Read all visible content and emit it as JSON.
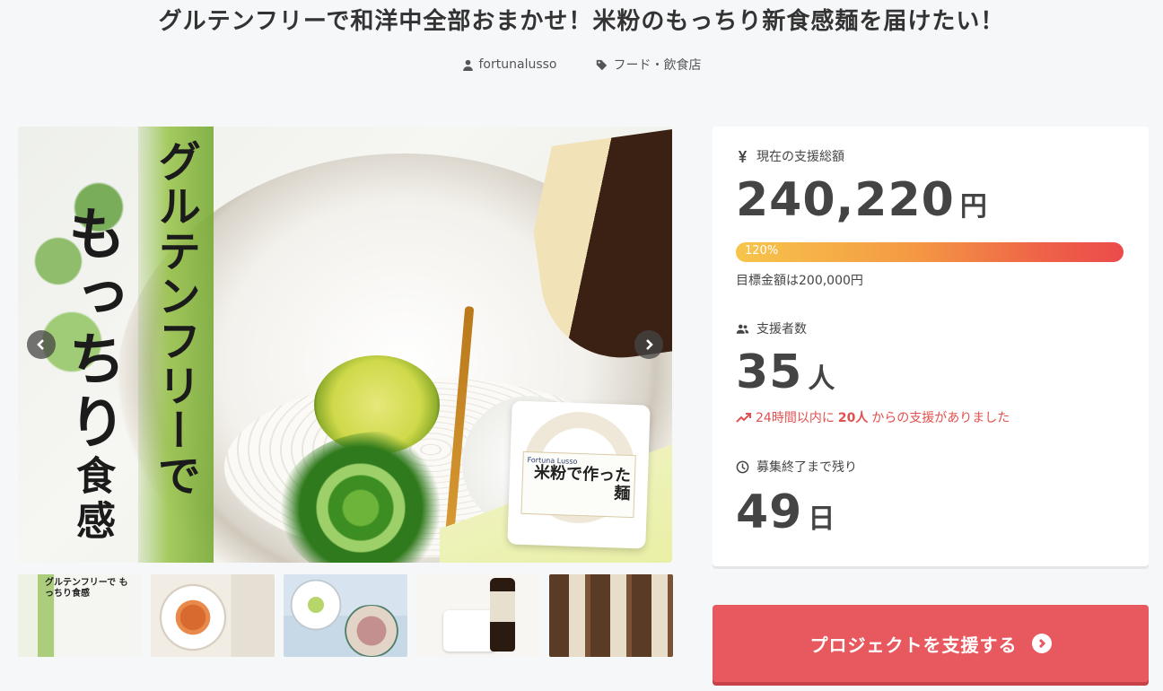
{
  "project": {
    "title": "グルテンフリーで和洋中全部おまかせ！米粉のもっちり新食感麺を届けたい！",
    "owner": "fortunalusso",
    "category": "フード・飲食店"
  },
  "hero": {
    "band_text_a": "グルテンフリーで",
    "band_text_b": "もっちり",
    "band_text_b_small": "食感",
    "package_brand": "Fortuna Lusso",
    "package_title": "米粉で作った麺"
  },
  "thumbnails": {
    "thumb1_text": "グルテンフリーで もっちり食感"
  },
  "stats": {
    "amount_label": "現在の支援総額",
    "amount_value": "240,220",
    "amount_unit": "円",
    "progress_percent": "120%",
    "progress_fraction": 1.2,
    "goal_text": "目標金額は200,000円",
    "backers_label": "支援者数",
    "backers_value": "35",
    "backers_unit": "人",
    "trend_prefix": "24時間以内に",
    "trend_count": "20人",
    "trend_suffix": "からの支援がありました",
    "remain_label": "募集終了まで残り",
    "remain_value": "49",
    "remain_unit": "日"
  },
  "actions": {
    "support_label": "プロジェクトを支援する"
  },
  "colors": {
    "accent": "#e8595f",
    "trend": "#e1504f",
    "progress_start": "#f7c54b",
    "progress_end": "#eb4b4b"
  },
  "icons": [
    "user-icon",
    "tag-icon",
    "yen-icon",
    "users-icon",
    "trend-up-icon",
    "clock-icon",
    "chevron-left-icon",
    "chevron-right-icon",
    "arrow-right-circle-icon"
  ]
}
